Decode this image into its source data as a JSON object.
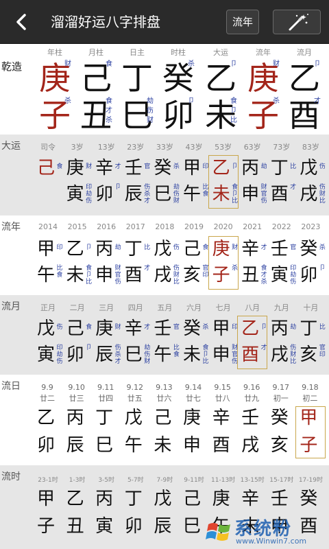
{
  "header": {
    "title": "溜溜好运八字排盘",
    "liunian_label": "流年"
  },
  "main_chart": {
    "label": "乾造",
    "columns": [
      {
        "head": "年柱",
        "stem": "庚",
        "stem_tag": "财",
        "branch": "子",
        "branch_tags": [
          "杀"
        ],
        "color": "red"
      },
      {
        "head": "月柱",
        "stem": "己",
        "stem_tag": "食",
        "branch": "丑",
        "branch_tags": [
          "食",
          "才",
          "杀"
        ],
        "color": "black"
      },
      {
        "head": "日主",
        "stem": "丁",
        "stem_tag": "",
        "branch": "巳",
        "branch_tags": [
          "劫",
          "伤",
          "财"
        ],
        "color": "black"
      },
      {
        "head": "时柱",
        "stem": "癸",
        "stem_tag": "杀",
        "branch": "卯",
        "branch_tags": [
          "卩"
        ],
        "color": "black"
      },
      {
        "head": "大运",
        "stem": "乙",
        "stem_tag": "卩",
        "branch": "未",
        "branch_tags": [
          "食",
          "卩",
          "比"
        ],
        "color": "black"
      },
      {
        "head": "流年",
        "stem": "庚",
        "stem_tag": "财",
        "branch": "子",
        "branch_tags": [
          "杀"
        ],
        "color": "red"
      },
      {
        "head": "流月",
        "stem": "乙",
        "stem_tag": "卩",
        "branch": "酉",
        "branch_tags": [
          "才"
        ],
        "color": "black"
      }
    ]
  },
  "dayun": {
    "label": "大运",
    "items": [
      {
        "head": "司令",
        "stem": "己",
        "branch": "",
        "tags": [
          "食"
        ],
        "color": "red",
        "hl": false
      },
      {
        "head": "3岁",
        "stem": "庚",
        "branch": "寅",
        "tags": [
          "财",
          "印",
          "劫",
          "伤"
        ],
        "color": "black",
        "hl": false
      },
      {
        "head": "13岁",
        "stem": "辛",
        "branch": "卯",
        "tags": [
          "才",
          "卩"
        ],
        "color": "black",
        "hl": false
      },
      {
        "head": "23岁",
        "stem": "壬",
        "branch": "辰",
        "tags": [
          "官",
          "伤",
          "杀",
          "才"
        ],
        "color": "black",
        "hl": false
      },
      {
        "head": "33岁",
        "stem": "癸",
        "branch": "巳",
        "tags": [
          "杀",
          "劫",
          "伤",
          "财"
        ],
        "color": "black",
        "hl": false
      },
      {
        "head": "43岁",
        "stem": "甲",
        "branch": "午",
        "tags": [
          "印",
          "比",
          "食"
        ],
        "color": "black",
        "hl": false
      },
      {
        "head": "53岁",
        "stem": "乙",
        "branch": "未",
        "tags": [
          "卩",
          "食",
          "卩",
          "比"
        ],
        "color": "red",
        "hl": true
      },
      {
        "head": "63岁",
        "stem": "丙",
        "branch": "申",
        "tags": [
          "劫",
          "财",
          "官",
          "伤"
        ],
        "color": "black",
        "hl": false
      },
      {
        "head": "73岁",
        "stem": "丁",
        "branch": "酉",
        "tags": [
          "比",
          "才"
        ],
        "color": "black",
        "hl": false
      },
      {
        "head": "83岁",
        "stem": "戊",
        "branch": "戌",
        "tags": [
          "伤",
          "伤",
          "财",
          "比"
        ],
        "color": "black",
        "hl": false
      }
    ]
  },
  "liunian": {
    "label": "流年",
    "items": [
      {
        "head": "2014",
        "stem": "甲",
        "branch": "午",
        "tags": [
          "印",
          "比",
          "食"
        ],
        "color": "black",
        "hl": false
      },
      {
        "head": "2015",
        "stem": "乙",
        "branch": "未",
        "tags": [
          "卩",
          "食",
          "卩",
          "比"
        ],
        "color": "black",
        "hl": false
      },
      {
        "head": "2016",
        "stem": "丙",
        "branch": "申",
        "tags": [
          "劫",
          "财",
          "官",
          "伤"
        ],
        "color": "black",
        "hl": false
      },
      {
        "head": "2017",
        "stem": "丁",
        "branch": "酉",
        "tags": [
          "比",
          "才"
        ],
        "color": "black",
        "hl": false
      },
      {
        "head": "2018",
        "stem": "戊",
        "branch": "戌",
        "tags": [
          "伤",
          "伤",
          "财",
          "比"
        ],
        "color": "black",
        "hl": false
      },
      {
        "head": "2019",
        "stem": "己",
        "branch": "亥",
        "tags": [
          "食",
          "官",
          "印"
        ],
        "color": "black",
        "hl": false
      },
      {
        "head": "2020",
        "stem": "庚",
        "branch": "子",
        "tags": [
          "财",
          "杀"
        ],
        "color": "red",
        "hl": true
      },
      {
        "head": "2021",
        "stem": "辛",
        "branch": "丑",
        "tags": [
          "才",
          "食",
          "才",
          "杀"
        ],
        "color": "black",
        "hl": false
      },
      {
        "head": "2022",
        "stem": "壬",
        "branch": "寅",
        "tags": [
          "官",
          "印",
          "劫",
          "伤"
        ],
        "color": "black",
        "hl": false
      },
      {
        "head": "2023",
        "stem": "癸",
        "branch": "卯",
        "tags": [
          "杀",
          "卩"
        ],
        "color": "black",
        "hl": false
      }
    ]
  },
  "liuyue": {
    "label": "流月",
    "items": [
      {
        "head": "正月",
        "stem": "戊",
        "branch": "寅",
        "tags": [
          "伤",
          "印",
          "劫",
          "伤"
        ],
        "color": "black",
        "hl": false
      },
      {
        "head": "二月",
        "stem": "己",
        "branch": "卯",
        "tags": [
          "食",
          "卩"
        ],
        "color": "black",
        "hl": false
      },
      {
        "head": "三月",
        "stem": "庚",
        "branch": "辰",
        "tags": [
          "财",
          "伤",
          "杀",
          "才"
        ],
        "color": "black",
        "hl": false
      },
      {
        "head": "四月",
        "stem": "辛",
        "branch": "巳",
        "tags": [
          "才",
          "劫",
          "伤",
          "财"
        ],
        "color": "black",
        "hl": false
      },
      {
        "head": "五月",
        "stem": "壬",
        "branch": "午",
        "tags": [
          "官",
          "比",
          "食"
        ],
        "color": "black",
        "hl": false
      },
      {
        "head": "六月",
        "stem": "癸",
        "branch": "未",
        "tags": [
          "杀",
          "食",
          "卩",
          "比"
        ],
        "color": "black",
        "hl": false
      },
      {
        "head": "七月",
        "stem": "甲",
        "branch": "申",
        "tags": [
          "印",
          "财",
          "官",
          "伤"
        ],
        "color": "black",
        "hl": false
      },
      {
        "head": "八月",
        "stem": "乙",
        "branch": "酉",
        "tags": [
          "卩",
          "才"
        ],
        "color": "red",
        "hl": true
      },
      {
        "head": "九月",
        "stem": "丙",
        "branch": "戌",
        "tags": [
          "劫",
          "伤",
          "财",
          "比"
        ],
        "color": "black",
        "hl": false
      },
      {
        "head": "十月",
        "stem": "丁",
        "branch": "亥",
        "tags": [
          "比",
          "官",
          "印"
        ],
        "color": "black",
        "hl": false
      }
    ]
  },
  "liuri": {
    "label": "流日",
    "items": [
      {
        "date": "9.9",
        "lunar": "廿二",
        "stem": "乙",
        "branch": "卯",
        "color": "black",
        "hl": false
      },
      {
        "date": "9.10",
        "lunar": "廿三",
        "stem": "丙",
        "branch": "辰",
        "color": "black",
        "hl": false
      },
      {
        "date": "9.11",
        "lunar": "廿四",
        "stem": "丁",
        "branch": "巳",
        "color": "black",
        "hl": false
      },
      {
        "date": "9.12",
        "lunar": "廿五",
        "stem": "戊",
        "branch": "午",
        "color": "black",
        "hl": false
      },
      {
        "date": "9.13",
        "lunar": "廿六",
        "stem": "己",
        "branch": "未",
        "color": "black",
        "hl": false
      },
      {
        "date": "9.14",
        "lunar": "廿七",
        "stem": "庚",
        "branch": "申",
        "color": "black",
        "hl": false
      },
      {
        "date": "9.15",
        "lunar": "廿八",
        "stem": "辛",
        "branch": "酉",
        "color": "black",
        "hl": false
      },
      {
        "date": "9.16",
        "lunar": "廿九",
        "stem": "壬",
        "branch": "戌",
        "color": "black",
        "hl": false
      },
      {
        "date": "9.17",
        "lunar": "初一",
        "stem": "癸",
        "branch": "亥",
        "color": "black",
        "hl": false
      },
      {
        "date": "9.18",
        "lunar": "初二",
        "stem": "甲",
        "branch": "子",
        "color": "red",
        "hl": true
      }
    ]
  },
  "liushi": {
    "label": "流时",
    "items": [
      {
        "head": "23-1时",
        "stem": "甲",
        "branch": "子"
      },
      {
        "head": "1-3时",
        "stem": "乙",
        "branch": "丑"
      },
      {
        "head": "3-5时",
        "stem": "丙",
        "branch": "寅"
      },
      {
        "head": "5-7时",
        "stem": "丁",
        "branch": "卯"
      },
      {
        "head": "7-9时",
        "stem": "戊",
        "branch": "辰"
      },
      {
        "head": "9-11时",
        "stem": "己",
        "branch": "巳"
      },
      {
        "head": "11-13时",
        "stem": "庚",
        "branch": "午"
      },
      {
        "head": "13-15时",
        "stem": "辛",
        "branch": "未"
      },
      {
        "head": "15-17时",
        "stem": "壬",
        "branch": "申"
      },
      {
        "head": "17-19时",
        "stem": "癸",
        "branch": "酉"
      }
    ]
  },
  "watermark": {
    "brand": "系统粉",
    "url": "www.Winwin7.com"
  },
  "colors": {
    "red": "#a3251a",
    "tag_blue": "#2a3fa0",
    "topbar": "#2a2a2a",
    "gray_bg": "#e6e6e6",
    "highlight_border": "#c9a64a"
  }
}
